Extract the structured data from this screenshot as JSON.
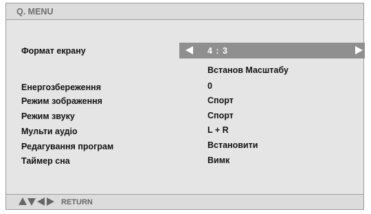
{
  "menu": {
    "title": "Q. MENU",
    "items": [
      {
        "label": "Формат екрану",
        "value": "4 : 3"
      },
      {
        "label": "",
        "value": "Встанов Масштабу"
      },
      {
        "label": "Енергозбереження",
        "value": "0"
      },
      {
        "label": "Режим зображення",
        "value": "Спорт"
      },
      {
        "label": "Режим звуку",
        "value": "Спорт"
      },
      {
        "label": "Мульти аудіо",
        "value": "L + R"
      },
      {
        "label": "Редагування програм",
        "value": "Встановити"
      },
      {
        "label": "Таймер сна",
        "value": "Вимк"
      }
    ]
  },
  "footer": {
    "nav_icons": [
      "up-arrow-icon",
      "down-arrow-icon",
      "left-arrow-icon",
      "right-arrow-icon"
    ],
    "return_label": "RETURN"
  },
  "colors": {
    "panel_background": "#e5e5e5",
    "header_background": "#dcdcdc",
    "selected_row": "#8f8f8f",
    "text": "#111111",
    "muted_text": "#6e6e6e"
  }
}
